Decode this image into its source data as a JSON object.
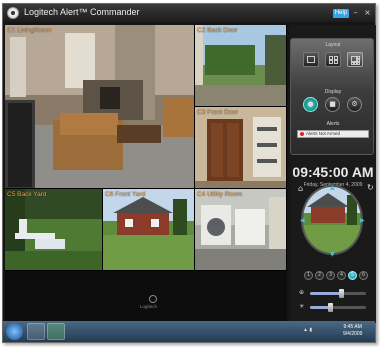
{
  "window": {
    "title": "Logitech Alert™ Commander",
    "help_label": "Help",
    "controls": [
      "minimize-icon",
      "maximize-icon",
      "close-icon"
    ]
  },
  "cameras": [
    {
      "label": "C1 LivingRoom"
    },
    {
      "label": "C2 Back Door"
    },
    {
      "label": "C3 Front Door"
    },
    {
      "label": "C5 Back Yard"
    },
    {
      "label": "C6 Front Yard"
    },
    {
      "label": "C4 Utility Room"
    }
  ],
  "branding": {
    "logo_text": "Logitech"
  },
  "side_panel": {
    "layout_label": "Layout",
    "display_label": "Display",
    "alerts_label": "Alerts",
    "alert_status": "Alerts Not Armed",
    "layout_options": [
      "single-view-icon",
      "quad-view-icon",
      "six-view-icon"
    ],
    "display_options": [
      "lock-icon",
      "record-icon",
      "settings-icon"
    ]
  },
  "clock": {
    "time": "09:45:00 AM",
    "date": "Friday, September 4, 2009"
  },
  "ptz": {
    "camera_numbers": [
      "1",
      "2",
      "3",
      "4",
      "5",
      "6"
    ],
    "selected_camera": "5",
    "zoom_level": 0.55,
    "brightness_level": 0.35
  },
  "taskbar": {
    "apps": [
      "explorer-icon",
      "media-icon",
      "commander-icon"
    ],
    "time": "9:45 AM",
    "date": "9/4/2009"
  },
  "colors": {
    "label_orange": "#e6a85a",
    "accent_teal": "#3fc4d0",
    "help_blue": "#3da3e3"
  }
}
